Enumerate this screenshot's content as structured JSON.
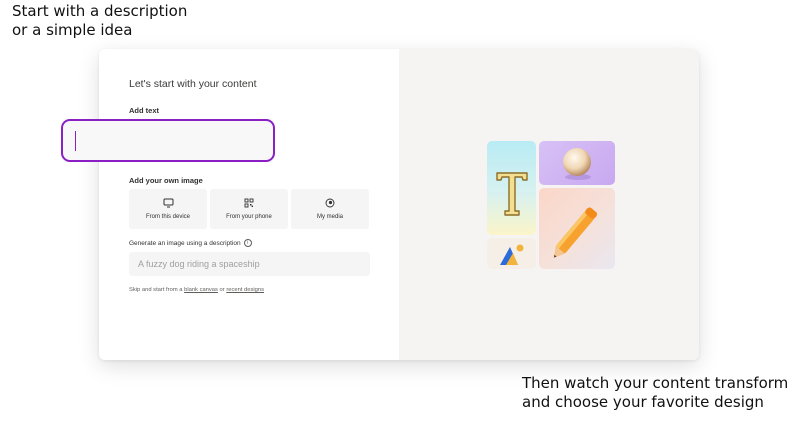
{
  "captions": {
    "top": "Start with a description\nor a simple idea",
    "bottom": "Then watch your content transform\nand choose your favorite design"
  },
  "panel": {
    "heading": "Let's start with your content",
    "add_text_label": "Add text",
    "text_input_value": "",
    "add_image_label": "Add your own image",
    "image_options": [
      {
        "label": "From this device",
        "icon": "monitor-icon"
      },
      {
        "label": "From your phone",
        "icon": "qr-code-icon"
      },
      {
        "label": "My media",
        "icon": "media-icon"
      }
    ],
    "generate_label": "Generate an image using a description",
    "generate_placeholder": "A fuzzy dog riding a spaceship",
    "skip_prefix": "Skip and start from a ",
    "blank_canvas_link": "blank canvas",
    "skip_middle": " or ",
    "recent_designs_link": "recent designs"
  },
  "colors": {
    "focus_border": "#8a1fc4",
    "preview_bg": "#f5f4f3"
  }
}
